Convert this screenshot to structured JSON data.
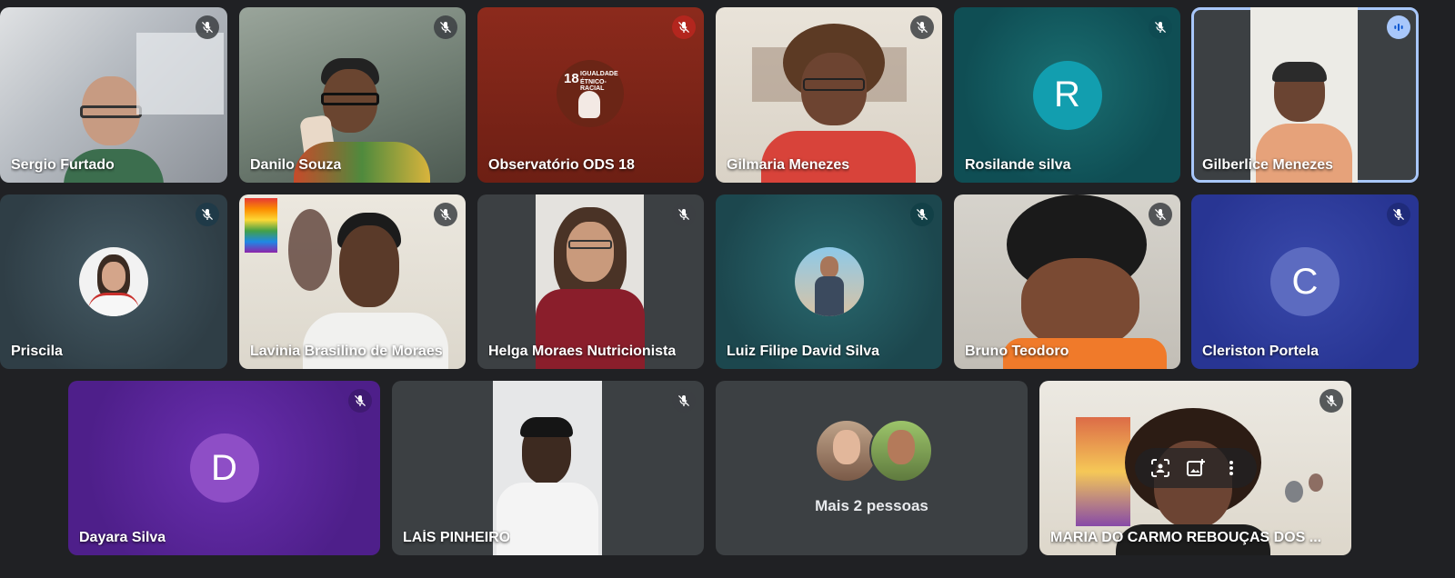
{
  "participants": {
    "sergio": {
      "name": "Sergio Furtado"
    },
    "danilo": {
      "name": "Danilo Souza"
    },
    "observatorio": {
      "name": "Observatório ODS 18",
      "logo_number": "18",
      "logo_text_1": "IGUALDADE",
      "logo_text_2": "ÉTNICO-RACIAL"
    },
    "gilmaria": {
      "name": "Gilmaria Menezes"
    },
    "rosilande": {
      "name": "Rosilande silva",
      "initial": "R"
    },
    "gilberlice": {
      "name": "Gilberlice Menezes"
    },
    "priscila": {
      "name": "Priscila"
    },
    "lavinia": {
      "name": "Lavinia Brasilino de Moraes"
    },
    "helga": {
      "name": "Helga Moraes Nutricionista"
    },
    "luiz": {
      "name": "Luiz Filipe David Silva"
    },
    "bruno": {
      "name": "Bruno Teodoro"
    },
    "cleriston": {
      "name": "Cleriston Portela",
      "initial": "C"
    },
    "dayara": {
      "name": "Dayara Silva",
      "initial": "D"
    },
    "lais": {
      "name": "LAÍS PINHEIRO"
    },
    "more": {
      "label": "Mais 2 pessoas"
    },
    "maria": {
      "name": "MARIA DO CARMO REBOUÇAS DOS ..."
    }
  },
  "icons": {
    "muted": "mic-off-icon",
    "speaking": "audio-level-icon",
    "frame": "frame-person-icon",
    "add_photo": "add-photo-icon",
    "more": "more-vert-icon"
  },
  "colors": {
    "background": "#202124",
    "speaking_outline": "#a8c7fa",
    "rosilande_avatar": "#129eaf",
    "cleriston_avatar": "#5c6bc0",
    "dayara_avatar": "#8e4ec6",
    "muted_red": "#b3261e"
  }
}
